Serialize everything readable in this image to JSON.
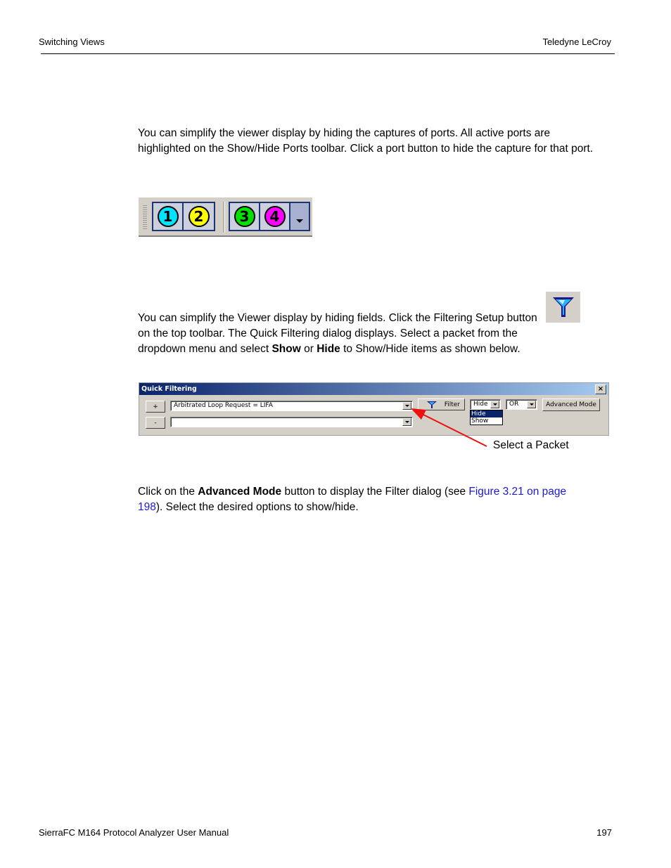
{
  "header": {
    "section": "Switching Views",
    "company": "Teledyne LeCroy"
  },
  "footer": {
    "manual": "SierraFC M164 Protocol Analyzer User Manual",
    "page": "197"
  },
  "para1": "You can simplify the viewer display by hiding the captures of ports. All active ports are highlighted on the Show/Hide Ports toolbar. Click a port button to hide the capture for that port.",
  "ports_toolbar": {
    "ports": [
      {
        "label": "1",
        "color": "#00e5ff"
      },
      {
        "label": "2",
        "color": "#ffff00"
      },
      {
        "label": "3",
        "color": "#00e000"
      },
      {
        "label": "4",
        "color": "#ff00ff"
      }
    ]
  },
  "para2": {
    "text": "You can simplify the Viewer display by hiding fields. Click the Filtering Setup button on the top toolbar. The Quick Filtering dialog displays. Select a packet from the dropdown menu and select ",
    "show": "Show",
    "or": " or ",
    "hide": "Hide",
    "tail": " to Show/Hide items as shown below."
  },
  "quick_filtering": {
    "title": "Quick Filtering",
    "close": "×",
    "add_button": "+",
    "remove_button": "-",
    "packet_combo_1": "Arbitrated Loop Request = LIFA",
    "packet_combo_2": "",
    "filter_button": "Filter",
    "mode_combo": "Hide",
    "mode_options": [
      "Hide",
      "Show"
    ],
    "logic_combo": "OR",
    "advanced_button": "Advanced Mode"
  },
  "callout": "Select a Packet",
  "para3": {
    "pre": "Click on the ",
    "bold": "Advanced Mode",
    "mid": " button to display the Filter dialog (see ",
    "link": "Figure 3.21 on page 198",
    "post": "). Select the desired options to show/hide."
  }
}
